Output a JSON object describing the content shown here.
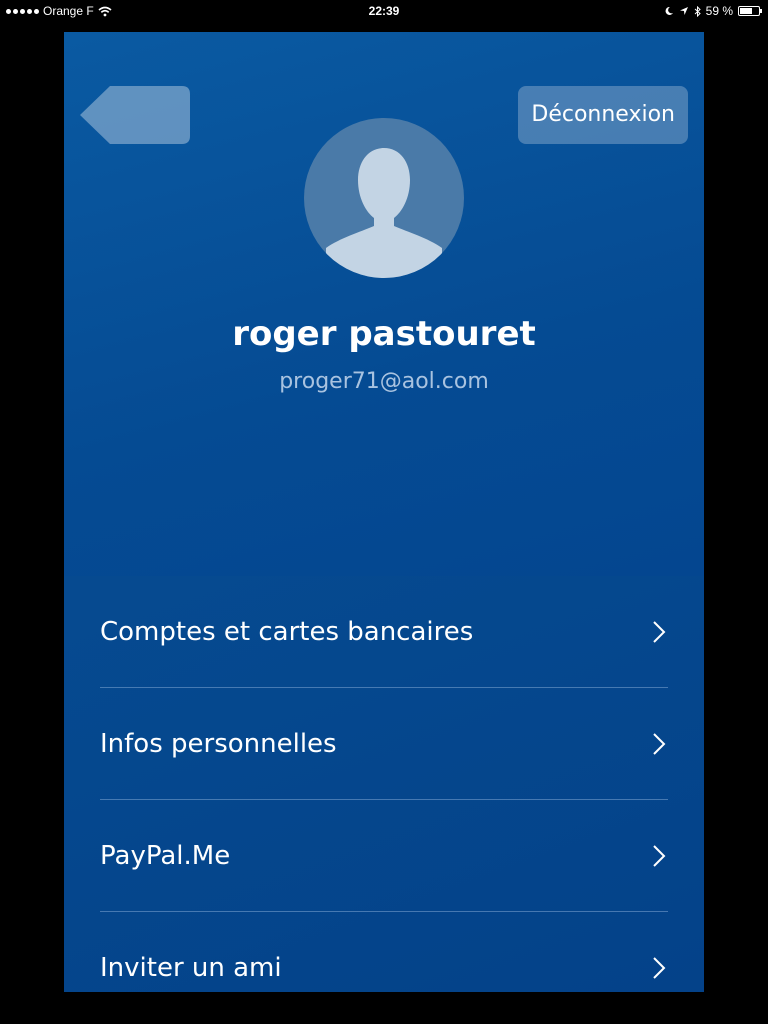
{
  "status_bar": {
    "carrier": "Orange F",
    "time": "22:39",
    "battery": "59 %"
  },
  "header": {
    "logout_label": "Déconnexion"
  },
  "profile": {
    "name": "roger pastouret",
    "email": "proger71@aol.com"
  },
  "menu": {
    "items": [
      {
        "label": "Comptes et cartes bancaires"
      },
      {
        "label": "Infos personnelles"
      },
      {
        "label": "PayPal.Me"
      },
      {
        "label": "Inviter un ami"
      }
    ]
  },
  "colors": {
    "background_blue": "#064c92",
    "button_fill": "#7ea5cb",
    "text_white": "#ffffff",
    "email_text": "#a9c3e0"
  },
  "icons": {
    "back": "back-arrow-icon",
    "avatar": "user-silhouette-icon",
    "chevron": "chevron-right-icon"
  }
}
